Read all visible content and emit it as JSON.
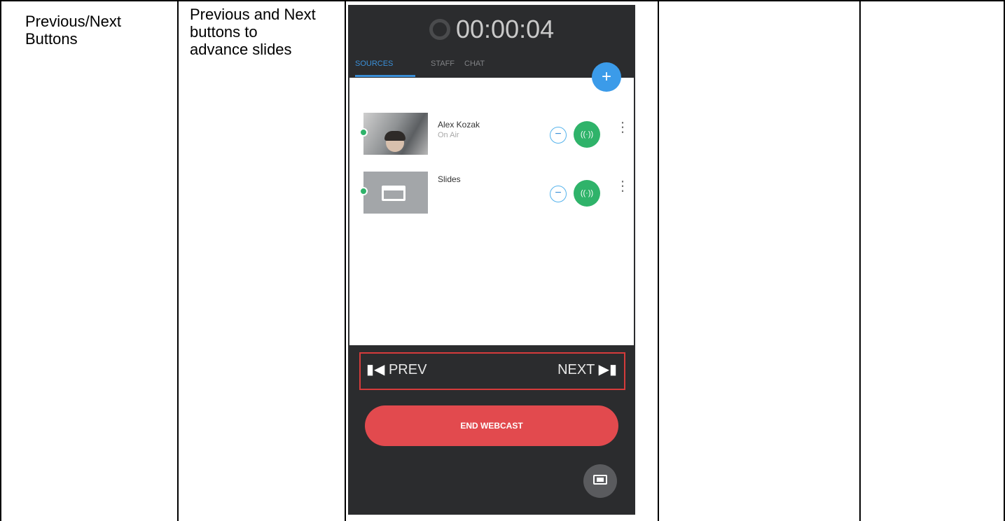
{
  "table": {
    "feature_cell": "Previous/Next\nButtons",
    "description_cell": "Previous and Next\nbuttons to\nadvance slides"
  },
  "app": {
    "timer": "00:00:04",
    "tabs": [
      {
        "label": "SOURCES",
        "active": true
      },
      {
        "label": "STAFF",
        "active": false
      },
      {
        "label": "CHAT",
        "active": false
      }
    ],
    "add_icon": "plus-icon",
    "sources": [
      {
        "name": "Alex Kozak",
        "status": "On Air",
        "thumb": "camera"
      },
      {
        "name": "Slides",
        "status": "",
        "thumb": "slides"
      }
    ],
    "nav": {
      "prev_label": "PREV",
      "next_label": "NEXT",
      "prev_icon": "▮◀",
      "next_icon": "▶▮"
    },
    "end_label": "END WEBCAST",
    "colors": {
      "accent": "#3a8fd8",
      "on_air": "#2fb36a",
      "end": "#e24a4e",
      "highlight": "#d63b3b",
      "panel": "#2b2c2e"
    }
  }
}
